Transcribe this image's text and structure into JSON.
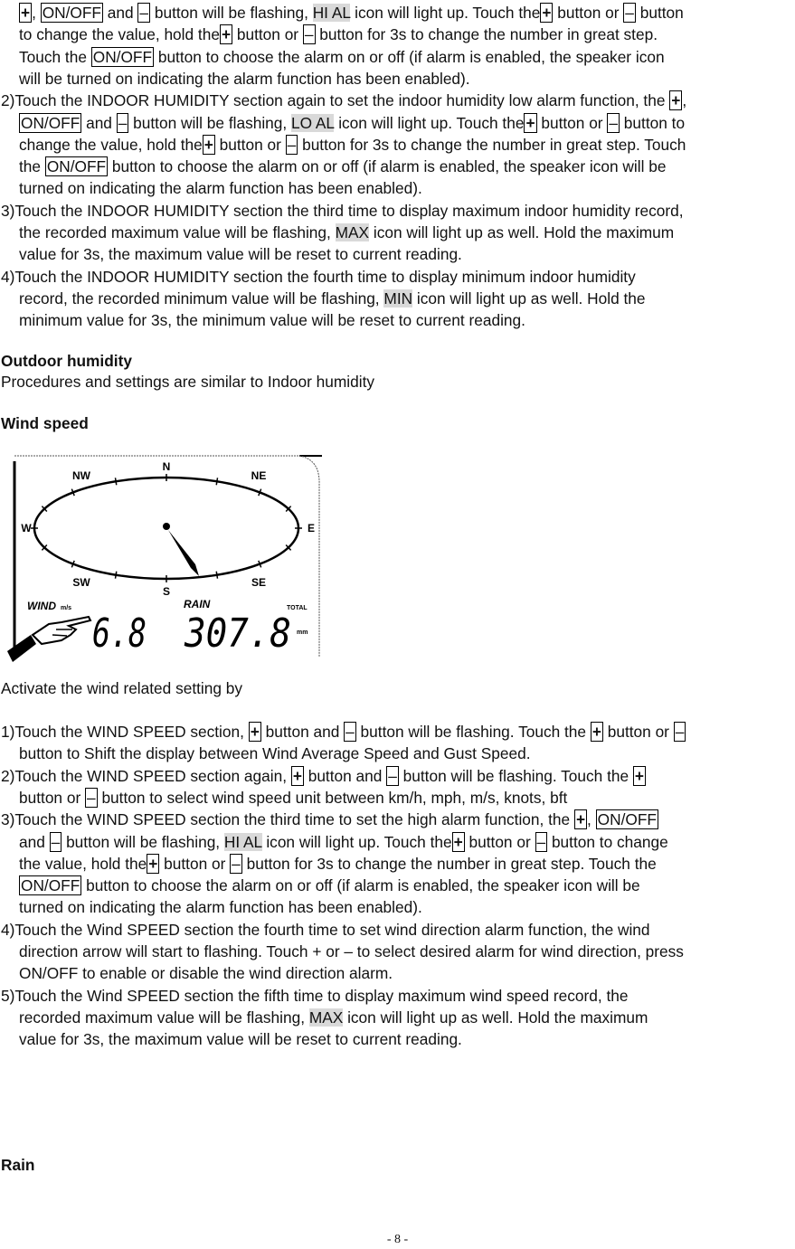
{
  "indoor_humidity": {
    "cont_lines": [
      [
        [
          "box",
          "+"
        ],
        [
          "t",
          ", "
        ],
        [
          "box",
          "ON/OFF"
        ],
        [
          "t",
          " and "
        ],
        [
          "box",
          "–"
        ],
        [
          "t",
          " button will be flashing, "
        ],
        [
          "hl",
          "HI AL"
        ],
        [
          "t",
          " icon will light up. Touch the"
        ],
        [
          "box",
          "+"
        ],
        [
          "t",
          " button or "
        ],
        [
          "box",
          "–"
        ],
        [
          "t",
          " button"
        ]
      ],
      [
        [
          "t",
          "to change the value, hold the"
        ],
        [
          "box",
          "+"
        ],
        [
          "t",
          " button or "
        ],
        [
          "box",
          "–"
        ],
        [
          "t",
          " button for 3s to change the number in great step."
        ]
      ],
      [
        [
          "t",
          "Touch the "
        ],
        [
          "box",
          "ON/OFF"
        ],
        [
          "t",
          " button to choose the alarm on or off (if alarm is enabled, the speaker icon"
        ]
      ],
      [
        [
          "t",
          "will be turned on indicating the alarm function has been enabled)."
        ]
      ]
    ],
    "items": [
      {
        "lines": [
          [
            [
              "t",
              "2)Touch the INDOOR HUMIDITY section again to set the indoor humidity low alarm function, the "
            ],
            [
              "box",
              "+"
            ],
            [
              "t",
              ","
            ]
          ],
          [
            [
              "box",
              "ON/OFF"
            ],
            [
              "t",
              " and "
            ],
            [
              "box",
              "–"
            ],
            [
              "t",
              " button will be flashing, "
            ],
            [
              "hl",
              "LO AL"
            ],
            [
              "t",
              " icon will light up. Touch the"
            ],
            [
              "box",
              "+"
            ],
            [
              "t",
              " button or "
            ],
            [
              "box",
              "–"
            ],
            [
              "t",
              " button to"
            ]
          ],
          [
            [
              "t",
              "change the value, hold the"
            ],
            [
              "box",
              "+"
            ],
            [
              "t",
              " button or "
            ],
            [
              "box",
              "–"
            ],
            [
              "t",
              " button for 3s to change the number in great step. Touch"
            ]
          ],
          [
            [
              "t",
              "the "
            ],
            [
              "box",
              "ON/OFF"
            ],
            [
              "t",
              " button to choose the alarm on or off (if alarm is enabled, the speaker icon will be"
            ]
          ],
          [
            [
              "t",
              "turned on indicating the alarm function has been enabled)."
            ]
          ]
        ]
      },
      {
        "lines": [
          [
            [
              "t",
              "3)Touch the INDOOR HUMIDITY section the third time to display maximum indoor humidity record,"
            ]
          ],
          [
            [
              "t",
              "the recorded maximum value will be flashing, "
            ],
            [
              "hl",
              "MAX"
            ],
            [
              "t",
              " icon will light up as well. Hold the maximum"
            ]
          ],
          [
            [
              "t",
              "value for 3s, the maximum value will be reset to current reading."
            ]
          ]
        ]
      },
      {
        "lines": [
          [
            [
              "t",
              "4)Touch the INDOOR HUMIDITY section the fourth time to display minimum indoor humidity"
            ]
          ],
          [
            [
              "t",
              "record, the recorded minimum value will be flashing, "
            ],
            [
              "hl",
              "MIN"
            ],
            [
              "t",
              " icon will light up as well. Hold the"
            ]
          ],
          [
            [
              "t",
              "minimum value for 3s, the minimum value will be reset to current reading."
            ]
          ]
        ]
      }
    ]
  },
  "outdoor_humidity": {
    "heading": "Outdoor humidity",
    "body": "Procedures and settings are similar to Indoor humidity"
  },
  "wind_speed": {
    "heading": "Wind speed",
    "figure": {
      "compass": [
        "N",
        "NE",
        "E",
        "SE",
        "S",
        "SW",
        "W",
        "NW"
      ],
      "wind_label": "WIND",
      "wind_unit": "m/s",
      "wind_value": "6.8",
      "rain_label": "RAIN",
      "rain_total_label": "TOTAL",
      "rain_value": "307.8",
      "rain_unit": "mm"
    },
    "intro": "Activate the wind related setting by",
    "items": [
      {
        "lines": [
          [
            [
              "t",
              "1)Touch the WIND SPEED section, "
            ],
            [
              "box",
              "+"
            ],
            [
              "t",
              " button and "
            ],
            [
              "box",
              "–"
            ],
            [
              "t",
              " button will be flashing. Touch the "
            ],
            [
              "box",
              "+"
            ],
            [
              "t",
              " button or "
            ],
            [
              "box",
              "–"
            ]
          ],
          [
            [
              "t",
              "button to Shift the display between Wind Average Speed and Gust Speed."
            ]
          ]
        ]
      },
      {
        "lines": [
          [
            [
              "t",
              "2)Touch the WIND SPEED section again, "
            ],
            [
              "box",
              "+"
            ],
            [
              "t",
              " button and "
            ],
            [
              "box",
              "–"
            ],
            [
              "t",
              " button will be flashing. Touch the "
            ],
            [
              "box",
              "+"
            ]
          ],
          [
            [
              "t",
              "button or "
            ],
            [
              "box",
              "–"
            ],
            [
              "t",
              " button to select wind speed unit between km/h, mph, m/s, knots, bft"
            ]
          ]
        ]
      },
      {
        "lines": [
          [
            [
              "t",
              "3)Touch the WIND SPEED section the third time to set the high alarm function, the "
            ],
            [
              "box",
              "+"
            ],
            [
              "t",
              ", "
            ],
            [
              "box",
              "ON/OFF"
            ]
          ],
          [
            [
              "t",
              "and "
            ],
            [
              "box",
              "–"
            ],
            [
              "t",
              " button will be flashing, "
            ],
            [
              "hl",
              "HI AL"
            ],
            [
              "t",
              " icon will light up. Touch the"
            ],
            [
              "box",
              "+"
            ],
            [
              "t",
              " button or "
            ],
            [
              "box",
              "–"
            ],
            [
              "t",
              " button to change"
            ]
          ],
          [
            [
              "t",
              "the value, hold the"
            ],
            [
              "box",
              "+"
            ],
            [
              "t",
              " button or "
            ],
            [
              "box",
              "–"
            ],
            [
              "t",
              " button for 3s to change the number in great step. Touch the"
            ]
          ],
          [
            [
              "box",
              "ON/OFF"
            ],
            [
              "t",
              " button to choose the alarm on or off (if alarm is enabled, the speaker icon will be"
            ]
          ],
          [
            [
              "t",
              "turned on indicating the alarm function has been enabled)."
            ]
          ]
        ]
      },
      {
        "lines": [
          [
            [
              "t",
              "4)Touch the Wind SPEED section the fourth time to set wind direction alarm function, the wind"
            ]
          ],
          [
            [
              "t",
              "direction arrow will start to flashing. Touch + or – to select desired alarm for wind direction, press"
            ]
          ],
          [
            [
              "t",
              "ON/OFF to enable or disable the wind direction alarm."
            ]
          ]
        ]
      },
      {
        "lines": [
          [
            [
              "t",
              "5)Touch the Wind SPEED section the fifth time to display maximum wind speed record, the"
            ]
          ],
          [
            [
              "t",
              "recorded maximum value will be flashing, "
            ],
            [
              "hl",
              "MAX"
            ],
            [
              "t",
              " icon will light up as well. Hold the maximum"
            ]
          ],
          [
            [
              "t",
              "value for 3s, the maximum value will be reset to current reading."
            ]
          ]
        ]
      }
    ]
  },
  "rain": {
    "heading": "Rain"
  },
  "footer": {
    "page_number": "- 8 -"
  }
}
